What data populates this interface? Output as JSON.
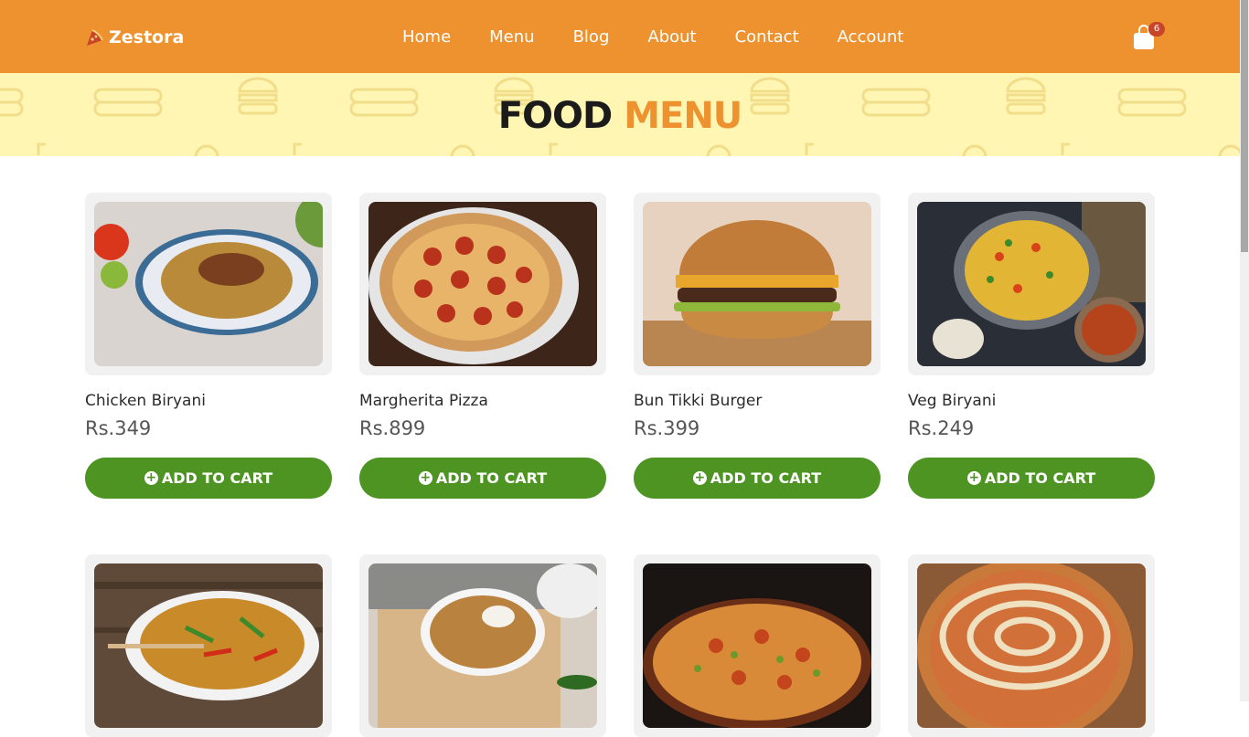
{
  "header": {
    "brand": "Zestora",
    "nav": [
      "Home",
      "Menu",
      "Blog",
      "About",
      "Contact",
      "Account"
    ],
    "cart_count": "6"
  },
  "banner": {
    "title_part1": "FOOD",
    "title_part2": "MENU"
  },
  "colors": {
    "header_bg": "#ee9230",
    "banner_bg": "#fff6b3",
    "accent": "#ee9230",
    "button": "#4d9423"
  },
  "products": [
    {
      "name": "Chicken Biryani",
      "price": "Rs.349",
      "button": "ADD TO CART"
    },
    {
      "name": "Margherita Pizza",
      "price": "Rs.899",
      "button": "ADD TO CART"
    },
    {
      "name": "Bun Tikki Burger",
      "price": "Rs.399",
      "button": "ADD TO CART"
    },
    {
      "name": "Veg Biryani",
      "price": "Rs.249",
      "button": "ADD TO CART"
    },
    {
      "name": "",
      "price": "",
      "button": ""
    },
    {
      "name": "",
      "price": "",
      "button": ""
    },
    {
      "name": "",
      "price": "",
      "button": ""
    },
    {
      "name": "",
      "price": "",
      "button": ""
    }
  ]
}
